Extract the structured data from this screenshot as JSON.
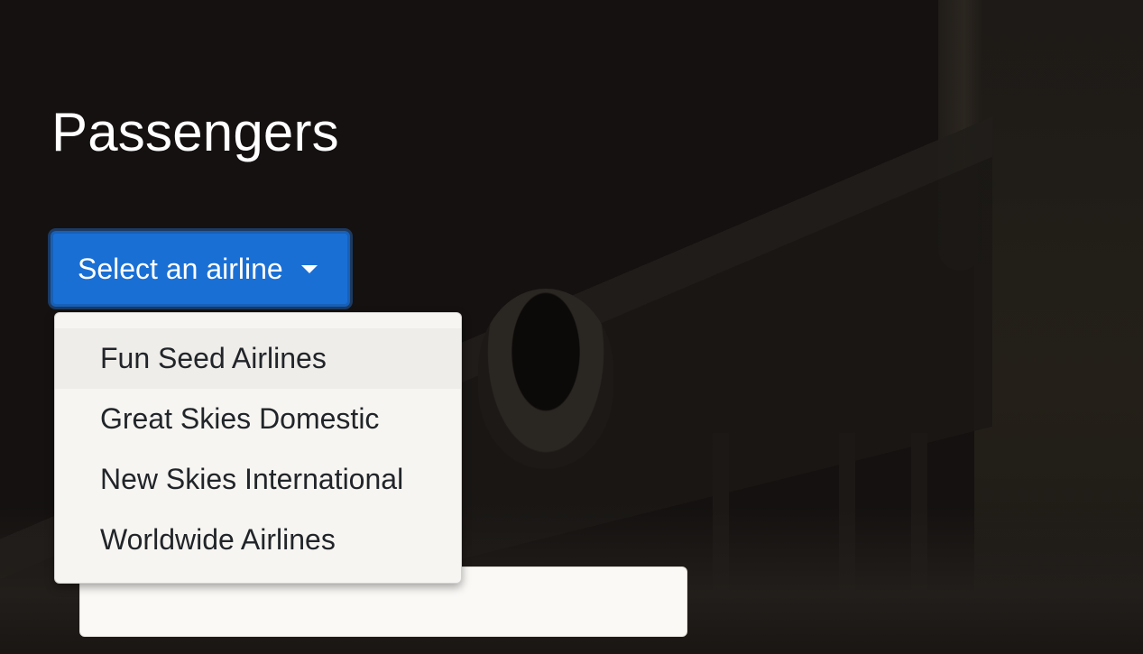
{
  "page": {
    "title": "Passengers"
  },
  "airline_select": {
    "label": "Select an airline",
    "icon": "caret-down-icon",
    "accent": "#1a6fd4",
    "options": [
      {
        "label": "Fun Seed Airlines",
        "highlighted": true
      },
      {
        "label": "Great Skies Domestic"
      },
      {
        "label": "New Skies International"
      },
      {
        "label": "Worldwide Airlines"
      }
    ]
  },
  "passenger_field": {
    "value": ""
  }
}
